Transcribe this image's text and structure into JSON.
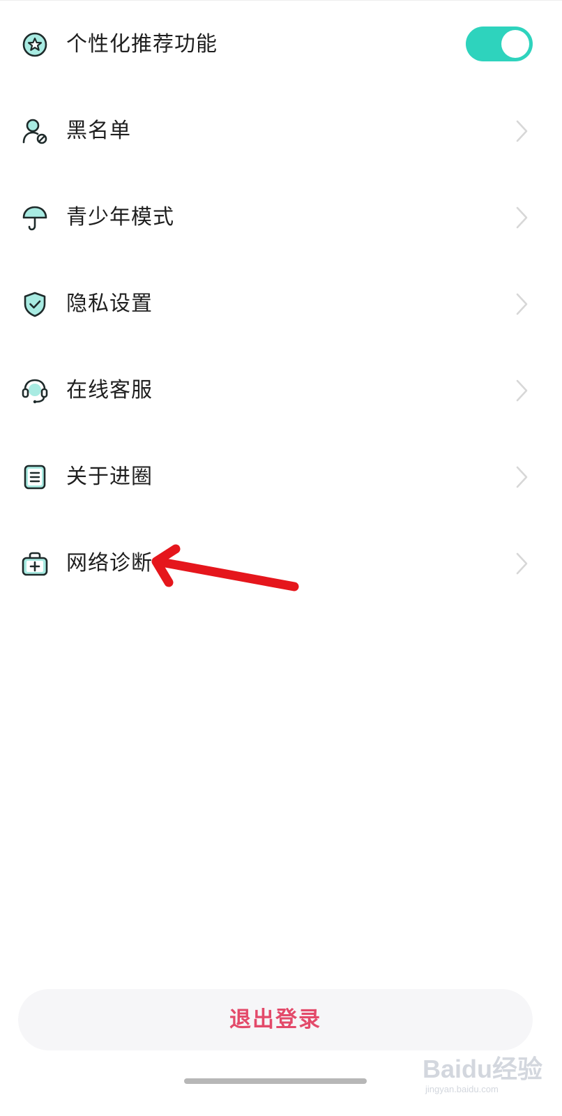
{
  "settings": {
    "items": [
      {
        "label": "个性化推荐功能",
        "icon": "star-badge-icon",
        "control": "toggle",
        "toggle_on": true
      },
      {
        "label": "黑名单",
        "icon": "user-block-icon",
        "control": "chevron"
      },
      {
        "label": "青少年模式",
        "icon": "umbrella-icon",
        "control": "chevron"
      },
      {
        "label": "隐私设置",
        "icon": "shield-check-icon",
        "control": "chevron"
      },
      {
        "label": "在线客服",
        "icon": "headset-icon",
        "control": "chevron"
      },
      {
        "label": "关于进圈",
        "icon": "document-icon",
        "control": "chevron"
      },
      {
        "label": "网络诊断",
        "icon": "medical-kit-icon",
        "control": "chevron"
      }
    ]
  },
  "logout": {
    "label": "退出登录"
  },
  "watermark": {
    "brand": "Baidu经验",
    "url": "jingyan.baidu.com"
  },
  "colors": {
    "accent": "#2ed3bd",
    "icon_fill": "#a8ebe2",
    "icon_stroke": "#1e2a2a",
    "logout_text": "#e34a6a",
    "annotation_arrow": "#e5161c"
  }
}
